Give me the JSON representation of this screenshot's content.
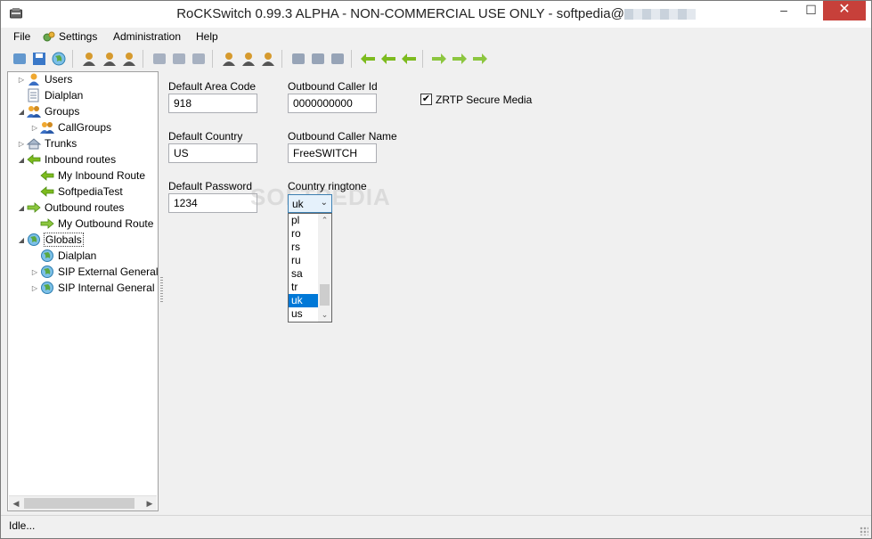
{
  "window": {
    "title": "RoCKSwitch 0.99.3 ALPHA - NON-COMMERCIAL USE ONLY - softpedia@"
  },
  "menu": {
    "file": "File",
    "settings": "Settings",
    "administration": "Administration",
    "help": "Help"
  },
  "toolbar": {
    "buttons": [
      "connect-icon",
      "save-icon",
      "globe-save-icon",
      "add-user-icon",
      "edit-user-icon",
      "remove-user-icon",
      "add-dialplan-icon",
      "edit-dialplan-icon",
      "remove-dialplan-icon",
      "add-group-icon",
      "edit-group-icon",
      "remove-group-icon",
      "add-trunk-icon",
      "edit-trunk-icon",
      "remove-trunk-icon",
      "add-inbound-icon",
      "edit-inbound-icon",
      "remove-inbound-icon",
      "add-outbound-icon",
      "edit-outbound-icon",
      "remove-outbound-icon"
    ]
  },
  "tree": [
    {
      "label": "Users",
      "icon": "users-icon",
      "level": 0,
      "expander": "collapsed"
    },
    {
      "label": "Dialplan",
      "icon": "dialplan-icon",
      "level": 0,
      "expander": "none"
    },
    {
      "label": "Groups",
      "icon": "groups-icon",
      "level": 0,
      "expander": "expanded"
    },
    {
      "label": "CallGroups",
      "icon": "callgroups-icon",
      "level": 1,
      "expander": "collapsed"
    },
    {
      "label": "Trunks",
      "icon": "trunks-icon",
      "level": 0,
      "expander": "collapsed"
    },
    {
      "label": "Inbound routes",
      "icon": "inbound-arrow-icon",
      "level": 0,
      "expander": "expanded"
    },
    {
      "label": "My Inbound Route",
      "icon": "inbound-arrow-icon",
      "level": 1,
      "expander": "none"
    },
    {
      "label": "SoftpediaTest",
      "icon": "inbound-arrow-icon",
      "level": 1,
      "expander": "none"
    },
    {
      "label": "Outbound routes",
      "icon": "outbound-arrow-icon",
      "level": 0,
      "expander": "expanded"
    },
    {
      "label": "My Outbound Route",
      "icon": "outbound-arrow-icon",
      "level": 1,
      "expander": "none"
    },
    {
      "label": "Globals",
      "icon": "globe-icon",
      "level": 0,
      "expander": "expanded",
      "selected": true
    },
    {
      "label": "Dialplan",
      "icon": "globe-icon",
      "level": 1,
      "expander": "none"
    },
    {
      "label": "SIP External General",
      "icon": "globe-icon",
      "level": 1,
      "expander": "collapsed"
    },
    {
      "label": "SIP Internal General",
      "icon": "globe-icon",
      "level": 1,
      "expander": "collapsed"
    }
  ],
  "form": {
    "default_area_code": {
      "label": "Default Area Code",
      "value": "918"
    },
    "outbound_caller_id": {
      "label": "Outbound Caller Id",
      "value": "0000000000"
    },
    "zrtp": {
      "label": "ZRTP Secure Media",
      "checked": true
    },
    "default_country": {
      "label": "Default Country",
      "value": "US"
    },
    "outbound_caller_name": {
      "label": "Outbound Caller Name",
      "value": "FreeSWITCH"
    },
    "default_password": {
      "label": "Default Password",
      "value": "1234"
    },
    "country_ringtone": {
      "label": "Country ringtone",
      "value": "uk",
      "options": [
        "pl",
        "ro",
        "rs",
        "ru",
        "sa",
        "tr",
        "uk",
        "us"
      ],
      "selected_option": "uk"
    }
  },
  "watermark": "SOFTPEDIA",
  "status": {
    "text": "Idle..."
  },
  "colors": {
    "selection": "#0078d7",
    "close_button": "#c7403a",
    "inbound_arrow": "#7dbb1e",
    "outbound_arrow": "#8cc63f"
  }
}
